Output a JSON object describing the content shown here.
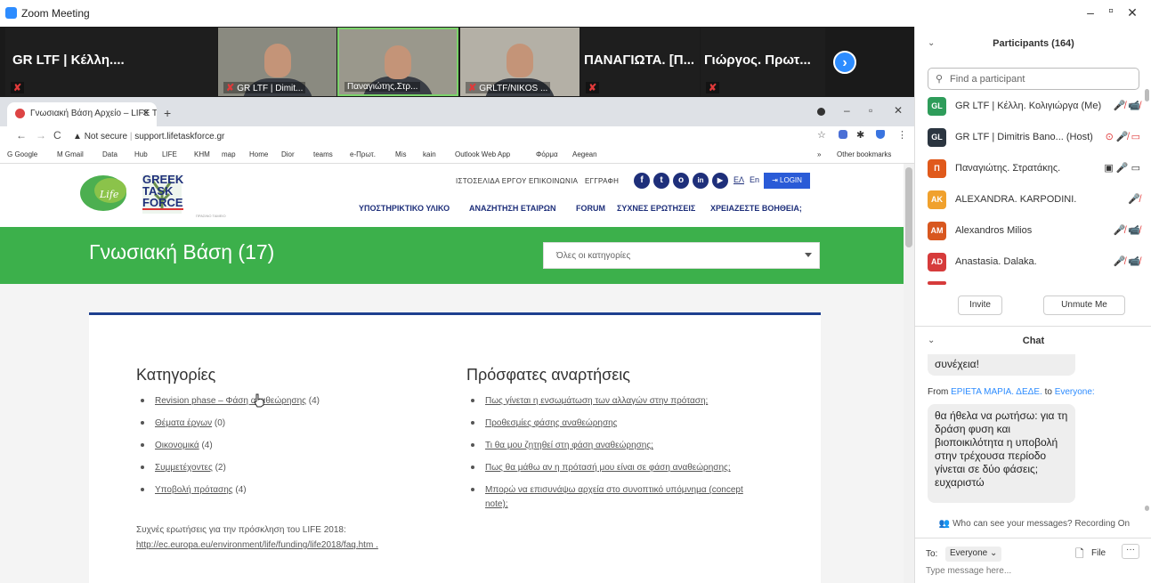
{
  "window": {
    "title": "Zoom Meeting",
    "controls": {
      "minimize": "–",
      "maximize": "▫",
      "close": "✕"
    }
  },
  "video_strip": {
    "tiles": [
      {
        "name": "GR LTF | Κέλλη....",
        "tag": ""
      },
      {
        "name": "",
        "tag": "GR LTF | Dimit..."
      },
      {
        "name": "",
        "tag": "Παναγιώτης.Στρ..."
      },
      {
        "name": "",
        "tag": "GRLTF/NIKOS ..."
      },
      {
        "name": "ΠΑΝΑΓΙΩΤΑ. [Π...",
        "tag": ""
      },
      {
        "name": "Γιώργος. Πρωτ...",
        "tag": ""
      }
    ],
    "next_arrow": "›"
  },
  "browser": {
    "tab_title": "Γνωσιακή Βάση Αρχείο – LIFE Ta",
    "tab_close": "✕",
    "new_tab": "+",
    "nav": {
      "back": "←",
      "forward": "→",
      "reload": "C"
    },
    "security": "Not secure",
    "url": "support.lifetaskforce.gr",
    "bookmarks": [
      "G Google",
      "M Gmail",
      "Data",
      "Hub",
      "LIFE",
      "KHM",
      "map",
      "Home",
      "Dior",
      "teams",
      "e-Πρωτ.",
      "Mis",
      "kain",
      "Outlook Web App",
      "Φόρμα",
      "Aegean"
    ],
    "bookmarks_more": "»",
    "other_bookmarks": "Other bookmarks"
  },
  "site": {
    "logo_lines": [
      "GREEK",
      "TASK",
      "FORCE"
    ],
    "logo_sub": "ΠΡΑΣΙΝΟ ΤΑΜΕΙΟ",
    "top_links": [
      "ΙΣΤΟΣΕΛΙΔΑ ΕΡΓΟΥ",
      "ΕΠΙΚΟΙΝΩΝΙΑ",
      "ΕΓΓΡΑΦΗ"
    ],
    "social": [
      "f",
      "t",
      "o",
      "in",
      "▶"
    ],
    "lang": [
      "ΕΛ",
      "En"
    ],
    "login": "LOGIN",
    "main_nav": [
      "ΥΠΟΣΤΗΡΙΚΤΙΚΟ ΥΛΙΚΟ",
      "ΑΝΑΖΗΤΗΣΗ ΕΤΑΙΡΩΝ",
      "FORUM",
      "ΣΥΧΝΕΣ ΕΡΩΤΗΣΕΙΣ",
      "ΧΡΕΙΑΖΕΣΤΕ ΒΟΗΘΕΙΑ;"
    ],
    "heading": "Γνωσιακή Βάση (17)",
    "category_select": "Όλες οι κατηγορίες",
    "categories_title": "Κατηγορίες",
    "categories": [
      {
        "label": "Revision phase – Φάση αναθεώρησης",
        "count": "(4)"
      },
      {
        "label": "Θέματα έργων",
        "count": "(0)"
      },
      {
        "label": "Οικονομικά",
        "count": "(4)"
      },
      {
        "label": "Συμμετέχοντες",
        "count": "(2)"
      },
      {
        "label": "Υποβολή πρότασης",
        "count": "(4)"
      }
    ],
    "recent_title": "Πρόσφατες αναρτήσεις",
    "recent": [
      "Πως γίνεται η ενσωμάτωση των αλλαγών στην πρόταση;",
      "Προθεσμίες φάσης αναθεώρησης",
      "Τι θα μου ζητηθεί στη φάση αναθεώρησης;",
      "Πως θα μάθω αν η πρότασή μου είναι σε φάση αναθεώρησης;",
      "Μπορώ να επισυνάψω αρχεία στο συνοπτικό υπόμνημα (concept",
      "note);"
    ],
    "faq_text": "Συχνές ερωτήσεις για την πρόσκληση του LIFE 2018:",
    "faq_url": "http://ec.europa.eu/environment/life/funding/life2018/faq.htm ."
  },
  "participants": {
    "title": "Participants (164)",
    "search_placeholder": "Find a participant",
    "list": [
      {
        "initials": "GL",
        "color": "#2e9c5a",
        "name": "GR LTF | Κέλλη. Κολιγιώργα (Me)",
        "icons": "🎤̸ 📹̸"
      },
      {
        "initials": "GL",
        "color": "#2b3540",
        "name": "GR LTF | Dimitris Bano... (Host)",
        "icons": "⊙ 🎤̸ ▭"
      },
      {
        "initials": "Π",
        "color": "#e0591b",
        "name": "Παναγιώτης. Στρατάκης.",
        "icons": "▣ 🎤 ▭"
      },
      {
        "initials": "AK",
        "color": "#f0a12d",
        "name": "ALEXANDRA. KARPODINI.",
        "icons": "🎤̸"
      },
      {
        "initials": "AM",
        "color": "#d8571f",
        "name": "Alexandros Milios",
        "icons": "🎤̸ 📹̸"
      },
      {
        "initials": "AD",
        "color": "#d63b3b",
        "name": "Anastasia. Dalaka.",
        "icons": "🎤̸ 📹̸"
      }
    ],
    "invite": "Invite",
    "unmute": "Unmute Me"
  },
  "chat": {
    "title": "Chat",
    "prev_message_tail": "συνέχεια!",
    "from_label": "From",
    "sender": "ΕΡΙΕΤΑ ΜΑΡΙΑ. ΔΕΔΕ.",
    "to_label": "to",
    "recipient": "Everyone:",
    "message": "θα ήθελα να ρωτήσω: για τη δράση φυση  και βιοποικιλότητα η υποβολή στην τρέχουσα περίοδο γίνεται σε δύο φάσεις; ευχαριστώ",
    "visibility": "Who can see your messages? Recording On",
    "to_prefix": "To:",
    "to_value": "Everyone",
    "file": "File",
    "more": "···",
    "input_placeholder": "Type message here..."
  }
}
